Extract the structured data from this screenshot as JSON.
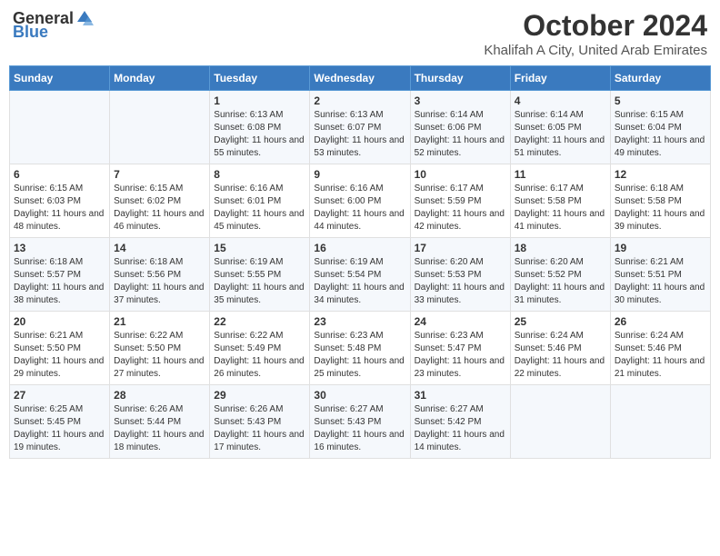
{
  "logo": {
    "text_general": "General",
    "text_blue": "Blue"
  },
  "header": {
    "month": "October 2024",
    "location": "Khalifah A City, United Arab Emirates"
  },
  "weekdays": [
    "Sunday",
    "Monday",
    "Tuesday",
    "Wednesday",
    "Thursday",
    "Friday",
    "Saturday"
  ],
  "weeks": [
    [
      {
        "day": "",
        "sunrise": "",
        "sunset": "",
        "daylight": ""
      },
      {
        "day": "",
        "sunrise": "",
        "sunset": "",
        "daylight": ""
      },
      {
        "day": "1",
        "sunrise": "Sunrise: 6:13 AM",
        "sunset": "Sunset: 6:08 PM",
        "daylight": "Daylight: 11 hours and 55 minutes."
      },
      {
        "day": "2",
        "sunrise": "Sunrise: 6:13 AM",
        "sunset": "Sunset: 6:07 PM",
        "daylight": "Daylight: 11 hours and 53 minutes."
      },
      {
        "day": "3",
        "sunrise": "Sunrise: 6:14 AM",
        "sunset": "Sunset: 6:06 PM",
        "daylight": "Daylight: 11 hours and 52 minutes."
      },
      {
        "day": "4",
        "sunrise": "Sunrise: 6:14 AM",
        "sunset": "Sunset: 6:05 PM",
        "daylight": "Daylight: 11 hours and 51 minutes."
      },
      {
        "day": "5",
        "sunrise": "Sunrise: 6:15 AM",
        "sunset": "Sunset: 6:04 PM",
        "daylight": "Daylight: 11 hours and 49 minutes."
      }
    ],
    [
      {
        "day": "6",
        "sunrise": "Sunrise: 6:15 AM",
        "sunset": "Sunset: 6:03 PM",
        "daylight": "Daylight: 11 hours and 48 minutes."
      },
      {
        "day": "7",
        "sunrise": "Sunrise: 6:15 AM",
        "sunset": "Sunset: 6:02 PM",
        "daylight": "Daylight: 11 hours and 46 minutes."
      },
      {
        "day": "8",
        "sunrise": "Sunrise: 6:16 AM",
        "sunset": "Sunset: 6:01 PM",
        "daylight": "Daylight: 11 hours and 45 minutes."
      },
      {
        "day": "9",
        "sunrise": "Sunrise: 6:16 AM",
        "sunset": "Sunset: 6:00 PM",
        "daylight": "Daylight: 11 hours and 44 minutes."
      },
      {
        "day": "10",
        "sunrise": "Sunrise: 6:17 AM",
        "sunset": "Sunset: 5:59 PM",
        "daylight": "Daylight: 11 hours and 42 minutes."
      },
      {
        "day": "11",
        "sunrise": "Sunrise: 6:17 AM",
        "sunset": "Sunset: 5:58 PM",
        "daylight": "Daylight: 11 hours and 41 minutes."
      },
      {
        "day": "12",
        "sunrise": "Sunrise: 6:18 AM",
        "sunset": "Sunset: 5:58 PM",
        "daylight": "Daylight: 11 hours and 39 minutes."
      }
    ],
    [
      {
        "day": "13",
        "sunrise": "Sunrise: 6:18 AM",
        "sunset": "Sunset: 5:57 PM",
        "daylight": "Daylight: 11 hours and 38 minutes."
      },
      {
        "day": "14",
        "sunrise": "Sunrise: 6:18 AM",
        "sunset": "Sunset: 5:56 PM",
        "daylight": "Daylight: 11 hours and 37 minutes."
      },
      {
        "day": "15",
        "sunrise": "Sunrise: 6:19 AM",
        "sunset": "Sunset: 5:55 PM",
        "daylight": "Daylight: 11 hours and 35 minutes."
      },
      {
        "day": "16",
        "sunrise": "Sunrise: 6:19 AM",
        "sunset": "Sunset: 5:54 PM",
        "daylight": "Daylight: 11 hours and 34 minutes."
      },
      {
        "day": "17",
        "sunrise": "Sunrise: 6:20 AM",
        "sunset": "Sunset: 5:53 PM",
        "daylight": "Daylight: 11 hours and 33 minutes."
      },
      {
        "day": "18",
        "sunrise": "Sunrise: 6:20 AM",
        "sunset": "Sunset: 5:52 PM",
        "daylight": "Daylight: 11 hours and 31 minutes."
      },
      {
        "day": "19",
        "sunrise": "Sunrise: 6:21 AM",
        "sunset": "Sunset: 5:51 PM",
        "daylight": "Daylight: 11 hours and 30 minutes."
      }
    ],
    [
      {
        "day": "20",
        "sunrise": "Sunrise: 6:21 AM",
        "sunset": "Sunset: 5:50 PM",
        "daylight": "Daylight: 11 hours and 29 minutes."
      },
      {
        "day": "21",
        "sunrise": "Sunrise: 6:22 AM",
        "sunset": "Sunset: 5:50 PM",
        "daylight": "Daylight: 11 hours and 27 minutes."
      },
      {
        "day": "22",
        "sunrise": "Sunrise: 6:22 AM",
        "sunset": "Sunset: 5:49 PM",
        "daylight": "Daylight: 11 hours and 26 minutes."
      },
      {
        "day": "23",
        "sunrise": "Sunrise: 6:23 AM",
        "sunset": "Sunset: 5:48 PM",
        "daylight": "Daylight: 11 hours and 25 minutes."
      },
      {
        "day": "24",
        "sunrise": "Sunrise: 6:23 AM",
        "sunset": "Sunset: 5:47 PM",
        "daylight": "Daylight: 11 hours and 23 minutes."
      },
      {
        "day": "25",
        "sunrise": "Sunrise: 6:24 AM",
        "sunset": "Sunset: 5:46 PM",
        "daylight": "Daylight: 11 hours and 22 minutes."
      },
      {
        "day": "26",
        "sunrise": "Sunrise: 6:24 AM",
        "sunset": "Sunset: 5:46 PM",
        "daylight": "Daylight: 11 hours and 21 minutes."
      }
    ],
    [
      {
        "day": "27",
        "sunrise": "Sunrise: 6:25 AM",
        "sunset": "Sunset: 5:45 PM",
        "daylight": "Daylight: 11 hours and 19 minutes."
      },
      {
        "day": "28",
        "sunrise": "Sunrise: 6:26 AM",
        "sunset": "Sunset: 5:44 PM",
        "daylight": "Daylight: 11 hours and 18 minutes."
      },
      {
        "day": "29",
        "sunrise": "Sunrise: 6:26 AM",
        "sunset": "Sunset: 5:43 PM",
        "daylight": "Daylight: 11 hours and 17 minutes."
      },
      {
        "day": "30",
        "sunrise": "Sunrise: 6:27 AM",
        "sunset": "Sunset: 5:43 PM",
        "daylight": "Daylight: 11 hours and 16 minutes."
      },
      {
        "day": "31",
        "sunrise": "Sunrise: 6:27 AM",
        "sunset": "Sunset: 5:42 PM",
        "daylight": "Daylight: 11 hours and 14 minutes."
      },
      {
        "day": "",
        "sunrise": "",
        "sunset": "",
        "daylight": ""
      },
      {
        "day": "",
        "sunrise": "",
        "sunset": "",
        "daylight": ""
      }
    ]
  ]
}
